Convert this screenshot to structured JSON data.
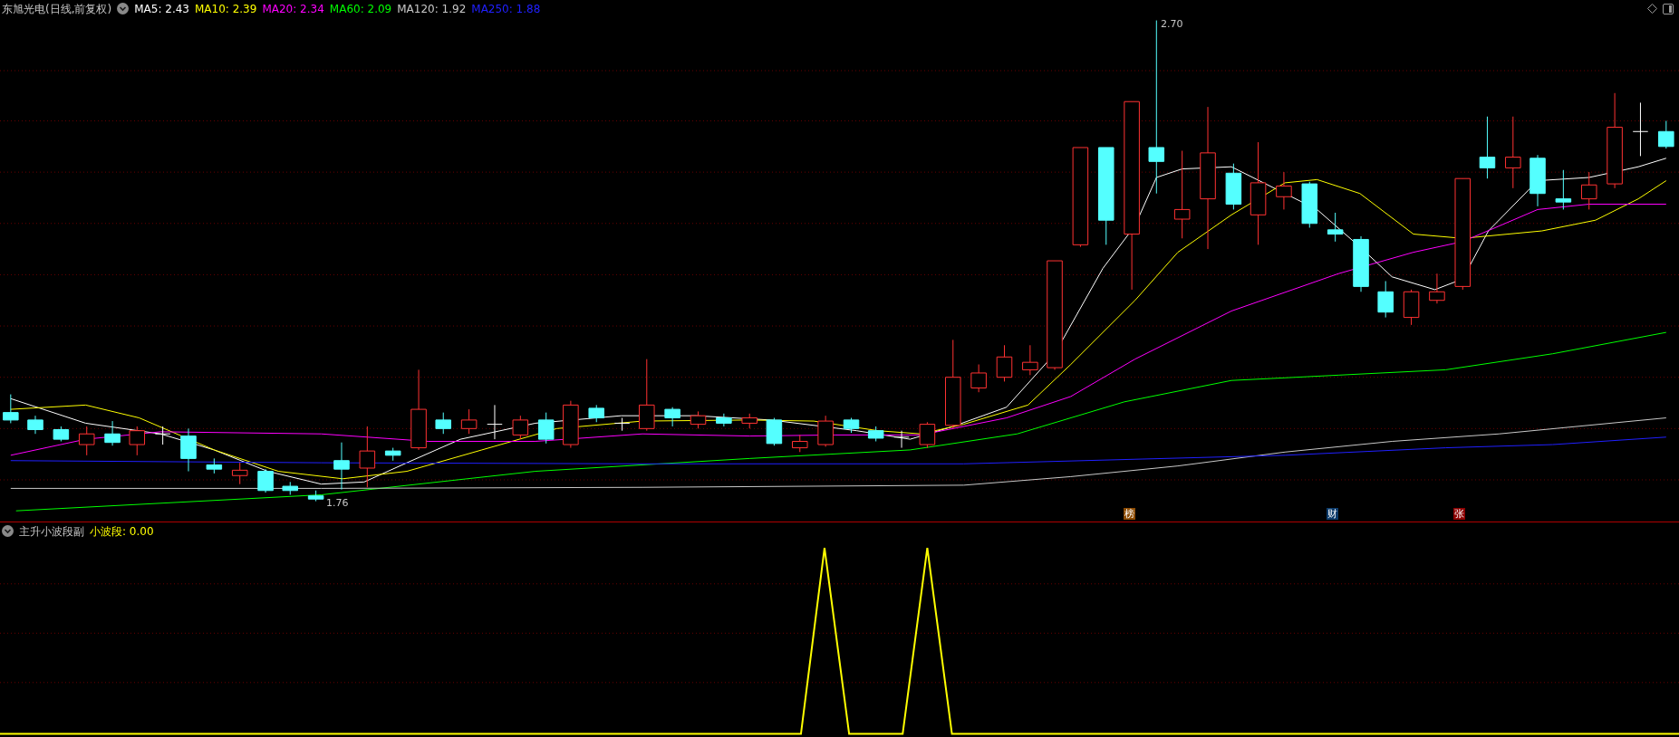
{
  "stock": {
    "title": "东旭光电(日线,前复权)",
    "indicators": [
      {
        "label": "MA5: 2.43",
        "color": "#ffffff"
      },
      {
        "label": "MA10: 2.39",
        "color": "#ffff00"
      },
      {
        "label": "MA20: 2.34",
        "color": "#ff00ff"
      },
      {
        "label": "MA60: 2.09",
        "color": "#00ff00"
      },
      {
        "label": "MA120: 1.92",
        "color": "#c8c8c8"
      },
      {
        "label": "MA250: 1.88",
        "color": "#2020ff"
      }
    ]
  },
  "chart": {
    "high_label": "2.70",
    "low_label": "1.76",
    "markers": [
      {
        "text": "榜",
        "color": "#8b4a00"
      },
      {
        "text": "财",
        "color": "#0b3a6a"
      },
      {
        "text": "张",
        "color": "#8b0000"
      }
    ]
  },
  "sub_indicator": {
    "title": "主升小波段副",
    "value": "小波段: 0.00"
  }
}
